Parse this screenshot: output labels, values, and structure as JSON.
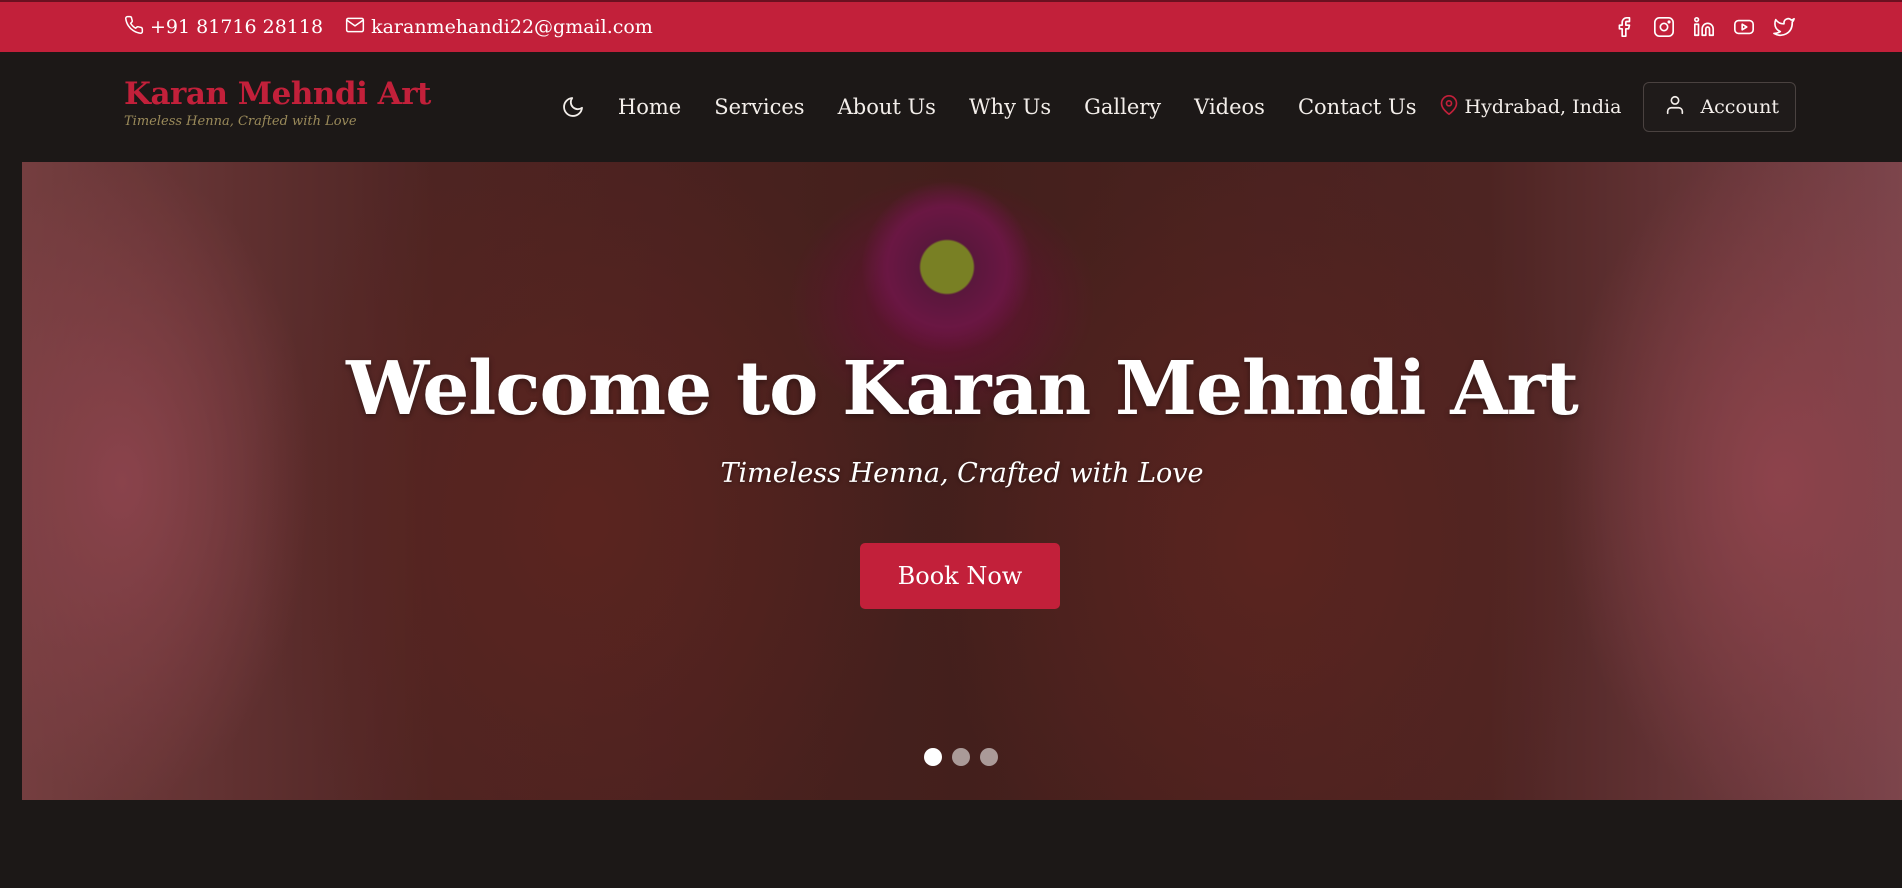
{
  "topbar": {
    "phone": "+91 81716 28118",
    "email": "karanmehandi22@gmail.com",
    "socials": [
      "facebook-icon",
      "instagram-icon",
      "linkedin-icon",
      "youtube-icon",
      "twitter-icon"
    ]
  },
  "brand": {
    "name": "Karan Mehndi Art",
    "tagline": "Timeless Henna, Crafted with Love"
  },
  "nav": {
    "items": [
      "Home",
      "Services",
      "About Us",
      "Why Us",
      "Gallery",
      "Videos",
      "Contact Us"
    ],
    "location": "Hydrabad, India",
    "account_label": "Account"
  },
  "hero": {
    "title": "Welcome to Karan Mehndi Art",
    "subtitle": "Timeless Henna, Crafted with Love",
    "cta_label": "Book Now",
    "slide_count": 3,
    "active_slide": 1
  },
  "colors": {
    "accent": "#c2203a",
    "background": "#1c1817",
    "text": "#f3eeea"
  }
}
